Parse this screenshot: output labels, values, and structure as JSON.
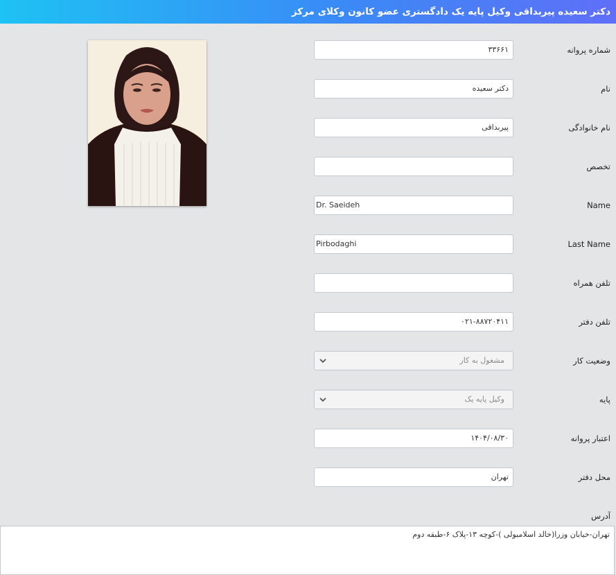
{
  "header": {
    "title": "دکتر سعیده پیربداقی وکیل پایه یک دادگستری عضو کانون وکلای مرکز"
  },
  "photo": {
    "alt": "عکس وکیل"
  },
  "fields": [
    {
      "label": "شماره پروانه",
      "value": "۳۳۶۶۱"
    },
    {
      "label": "نام",
      "value": "دکتر سعیده"
    },
    {
      "label": "نام خانوادگی",
      "value": "پیربداقی"
    },
    {
      "label": "تخصص",
      "value": ""
    },
    {
      "label": "Name",
      "value": "Dr. Saeideh"
    },
    {
      "label": "Last Name",
      "value": "Pirbodaghi"
    },
    {
      "label": "تلفن همراه",
      "value": ""
    },
    {
      "label": "تلفن دفتر",
      "value": "۰۲۱-۸۸۷۲۰۴۱۱"
    },
    {
      "label": "وضعیت کار",
      "value": "مشغول به کار"
    },
    {
      "label": "پایه",
      "value": "وکیل پایه یک"
    },
    {
      "label": "اعتبار پروانه",
      "value": "۱۴۰۴/۰۸/۳۰"
    },
    {
      "label": "محل دفتر",
      "value": "تهران"
    }
  ],
  "address": {
    "label": "آدرس",
    "value": "تهران-خیابان وزرا(خالد اسلامبولی )-کوچه ۱۳-پلاک ۶-طبقه دوم"
  },
  "icons": {
    "select_arrow": "chevron-down-icon"
  },
  "colors": {
    "header_start": "#1ec2f3",
    "header_end": "#5f6ff7",
    "background": "#e4e5e7"
  }
}
